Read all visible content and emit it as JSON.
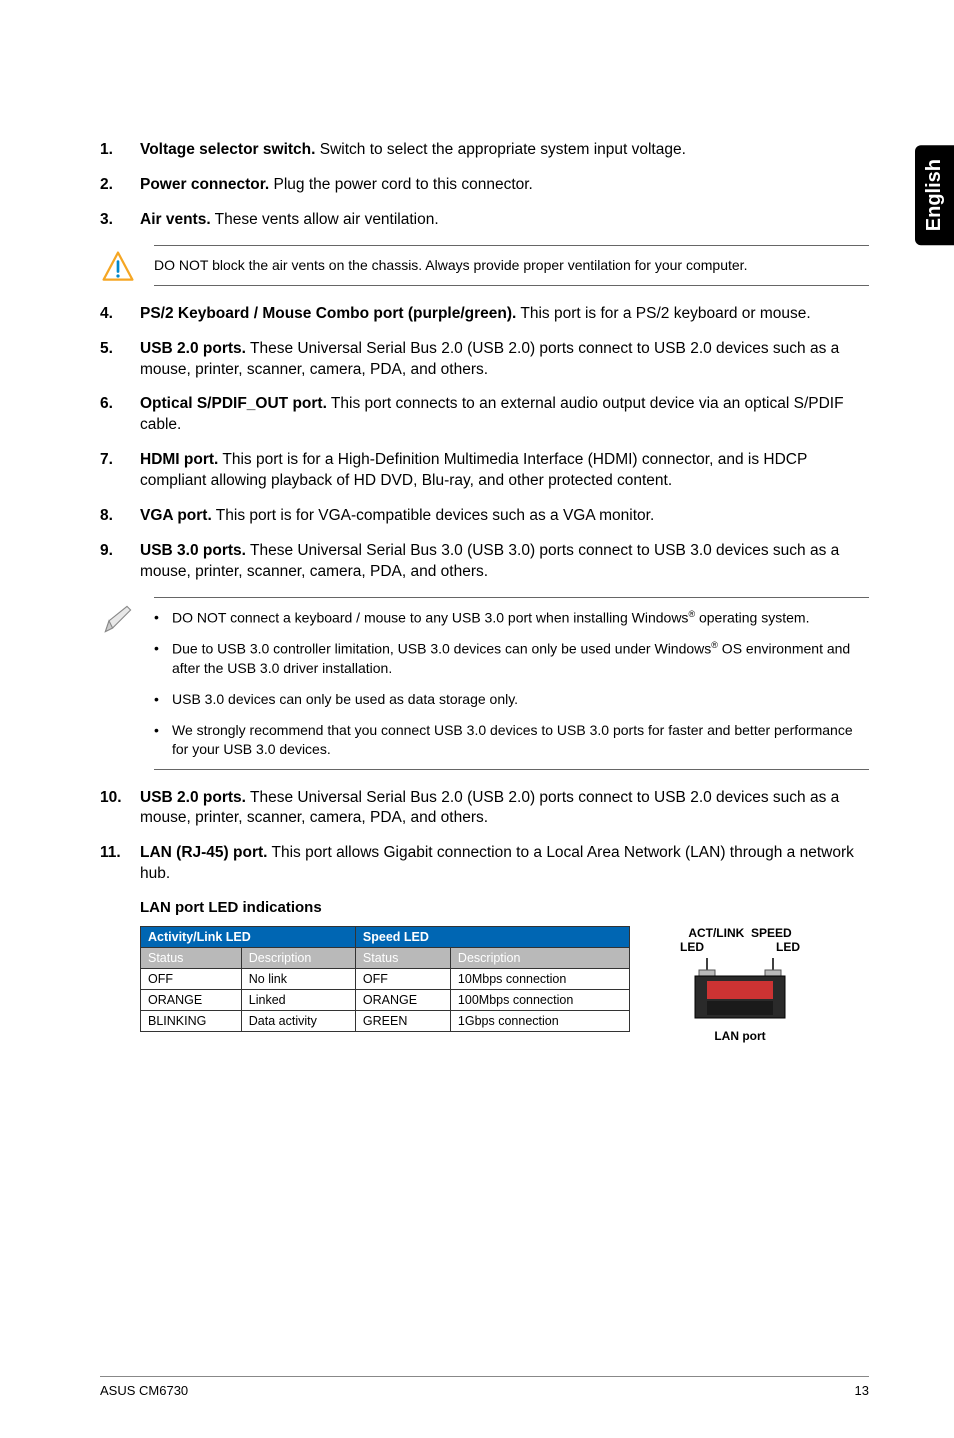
{
  "sideTab": "English",
  "items": [
    {
      "num": "1.",
      "bold": "Voltage selector switch.",
      "rest": " Switch to select the appropriate system input voltage."
    },
    {
      "num": "2.",
      "bold": "Power connector.",
      "rest": " Plug the power cord to this connector."
    },
    {
      "num": "3.",
      "bold": "Air vents.",
      "rest": " These vents allow air ventilation."
    }
  ],
  "warning": "DO NOT block the air vents on the chassis. Always provide proper ventilation for your computer.",
  "items2": [
    {
      "num": "4.",
      "bold": "PS/2 Keyboard / Mouse Combo port (purple/green).",
      "rest": " This port is for a PS/2 keyboard or mouse."
    },
    {
      "num": "5.",
      "bold": "USB 2.0 ports.",
      "rest": " These Universal Serial Bus 2.0 (USB 2.0) ports connect to USB 2.0 devices such as a mouse, printer, scanner, camera, PDA, and others."
    },
    {
      "num": "6.",
      "bold": "Optical S/PDIF_OUT port.",
      "rest": " This port connects to an external audio output device via an optical S/PDIF cable."
    },
    {
      "num": "7.",
      "bold": "HDMI port.",
      "rest": " This port is for a High-Definition Multimedia Interface (HDMI) connector, and is HDCP compliant allowing playback of HD DVD, Blu-ray, and other protected content."
    },
    {
      "num": "8.",
      "bold": "VGA port.",
      "rest": " This port is for VGA-compatible devices such as a VGA monitor."
    },
    {
      "num": "9.",
      "bold": "USB 3.0 ports.",
      "rest": " These Universal Serial Bus 3.0 (USB 3.0) ports connect to USB 3.0 devices such as a mouse, printer, scanner, camera, PDA, and others."
    }
  ],
  "notes": [
    {
      "pre": "DO NOT connect a keyboard / mouse to any USB 3.0 port when installing Windows",
      "sup": "®",
      "post": " operating system."
    },
    {
      "pre": "Due to USB 3.0 controller limitation, USB 3.0 devices can only be used under Windows",
      "sup": "®",
      "post": " OS environment and after the USB 3.0 driver installation."
    },
    {
      "pre": "USB 3.0 devices can only be used as data storage only.",
      "sup": "",
      "post": ""
    },
    {
      "pre": "We strongly recommend that you connect USB 3.0 devices to USB 3.0 ports for faster and better performance for your USB 3.0 devices.",
      "sup": "",
      "post": ""
    }
  ],
  "items3": [
    {
      "num": "10.",
      "bold": "USB 2.0 ports.",
      "rest": " These Universal Serial Bus 2.0 (USB 2.0) ports connect to USB 2.0 devices such as a mouse, printer, scanner, camera, PDA, and others."
    },
    {
      "num": "11.",
      "bold": "LAN (RJ-45) port.",
      "rest": " This port allows Gigabit connection to a Local Area Network (LAN) through a network hub."
    }
  ],
  "subHeading": "LAN port LED indications",
  "table": {
    "h1a": "Activity/Link LED",
    "h1b": "Speed LED",
    "h2": [
      "Status",
      "Description",
      "Status",
      "Description"
    ],
    "rows": [
      [
        "OFF",
        "No link",
        "OFF",
        "10Mbps connection"
      ],
      [
        "ORANGE",
        "Linked",
        "ORANGE",
        "100Mbps connection"
      ],
      [
        "BLINKING",
        "Data activity",
        "GREEN",
        "1Gbps connection"
      ]
    ]
  },
  "diagram": {
    "title": "ACT/LINK",
    "colRight": "SPEED",
    "ledLeft": "LED",
    "ledRight": "LED",
    "caption": "LAN port"
  },
  "footer": {
    "left": "ASUS CM6730",
    "right": "13"
  }
}
